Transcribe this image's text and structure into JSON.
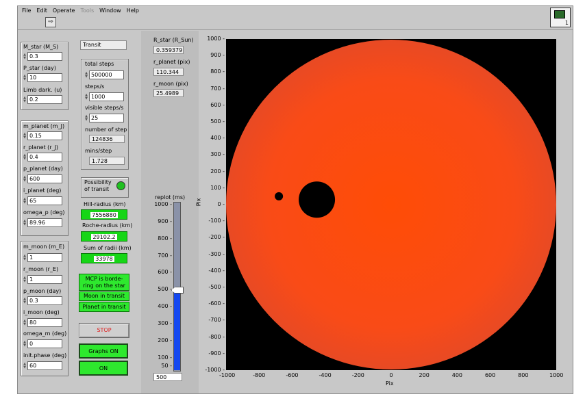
{
  "menu": [
    {
      "label": "File",
      "disabled": false
    },
    {
      "label": "Edit",
      "disabled": false
    },
    {
      "label": "Operate",
      "disabled": false
    },
    {
      "label": "Tools",
      "disabled": true
    },
    {
      "label": "Window",
      "disabled": false
    },
    {
      "label": "Help",
      "disabled": false
    }
  ],
  "toolbar": {
    "run_icon": "⇨",
    "vi_number": "1"
  },
  "star": {
    "m_star_label": "M_star (M_S)",
    "m_star": "0.3",
    "p_star_label": "P_star (day)",
    "p_star": "10",
    "limb_label": "Limb dark. (u)",
    "limb": "0.2"
  },
  "planet": {
    "m_label": "m_planet (m_J)",
    "m": "0.15",
    "r_label": "r_planet (r_J)",
    "r": "0.4",
    "p_label": "p_planet (day)",
    "p": "600",
    "i_label": "i_planet (deg)",
    "i": "65",
    "omega_label": "omega_p (deg)",
    "omega": "89.96"
  },
  "moon": {
    "m_label": "m_moon (m_E)",
    "m": "1",
    "r_label": "r_moon (r_E)",
    "r": "1",
    "p_label": "p_moon (day)",
    "p": "0.3",
    "i_label": "i_moon (deg)",
    "i": "80",
    "omega_label": "omega_m (deg)",
    "omega": "0",
    "phase_label": "init.phase (deg)",
    "phase": "60"
  },
  "transit": {
    "title": "Transit",
    "total_steps_label": "total steps",
    "total_steps": "500000",
    "steps_s_label": "steps/s",
    "steps_s": "1000",
    "visible_label": "visible steps/s",
    "visible": "25",
    "num_step_label": "number of step",
    "num_step": "124836",
    "mins_label": "mins/step",
    "mins": "1.728"
  },
  "possibility": {
    "label1": "Possibility",
    "label2": "of transit",
    "led_color": "#20c020"
  },
  "radii": {
    "hill_label": "Hill-radius (km)",
    "hill": "7556880",
    "roche_label": "Roche-radius (km)",
    "roche": "29102.2",
    "sum_label": "Sum of radii (km)",
    "sum": "33978"
  },
  "status": {
    "mcp_line1": "MCP is borde-",
    "mcp_line2": "ring on the star",
    "moon_transit": "Moon in transit",
    "planet_transit": "Planet in transit"
  },
  "buttons": {
    "stop": "STOP",
    "graphs": "Graphs ON",
    "on": "ON"
  },
  "readouts": {
    "r_star_label": "R_star (R_Sun)",
    "r_star": "0.359379",
    "r_planet_label": "r_planet (pix)",
    "r_planet": "110.344",
    "r_moon_label": "r_moon (pix)",
    "r_moon": "25.4989"
  },
  "replot": {
    "label": "replot (ms)",
    "ticks": [
      "1000",
      "900",
      "800",
      "700",
      "600",
      "500",
      "400",
      "300",
      "200",
      "100",
      "50"
    ],
    "value": 500,
    "value_text": "500"
  },
  "plot": {
    "xlabel": "Pix",
    "ylabel": "Pix",
    "xticks": [
      "-1000",
      "-800",
      "-600",
      "-400",
      "-200",
      "0",
      "200",
      "400",
      "600",
      "800",
      "1000"
    ],
    "yticks": [
      "1000",
      "900",
      "800",
      "700",
      "600",
      "500",
      "400",
      "300",
      "200",
      "100",
      "0",
      "-100",
      "-200",
      "-300",
      "-400",
      "-500",
      "-600",
      "-700",
      "-800",
      "-900",
      "-1000"
    ],
    "star_radius": 1000,
    "star_color": "#ff4a12",
    "planet": {
      "x": -450,
      "y": 30,
      "r": 110
    },
    "moon": {
      "x": -680,
      "y": 50,
      "r": 25
    }
  }
}
